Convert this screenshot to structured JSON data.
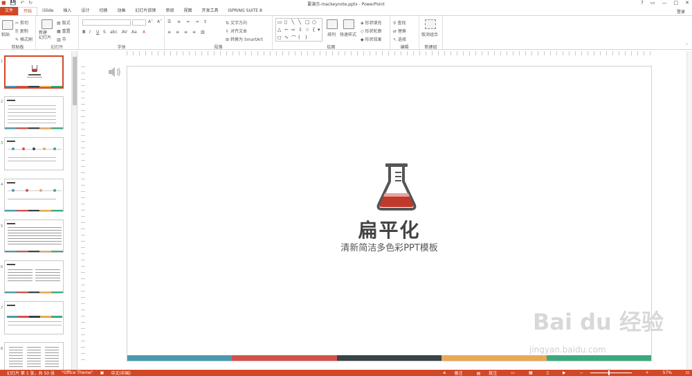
{
  "window": {
    "title": "要演示-mackeynote.pptx - PowerPoint",
    "controls": [
      "?",
      "▭",
      "—",
      "□",
      "✕"
    ],
    "signin": "登录"
  },
  "qat": {
    "save_icon": "save-icon",
    "undo_icon": "undo-icon",
    "redo_icon": "redo-icon"
  },
  "tabs": [
    {
      "label": "文件"
    },
    {
      "label": "开始"
    },
    {
      "label": "iSlide"
    },
    {
      "label": "插入"
    },
    {
      "label": "设计"
    },
    {
      "label": "切换"
    },
    {
      "label": "动画"
    },
    {
      "label": "幻灯片放映"
    },
    {
      "label": "审阅"
    },
    {
      "label": "视图"
    },
    {
      "label": "开发工具"
    },
    {
      "label": "ISPRING SUITE 8"
    }
  ],
  "ribbon": {
    "clipboard": {
      "label": "剪贴板",
      "paste": "粘贴",
      "cut": "剪切",
      "copy": "复制",
      "format_painter": "格式刷"
    },
    "slides": {
      "label": "幻灯片",
      "new_slide": "新建\n幻灯片",
      "layout": "版式",
      "reset": "重置",
      "section": "节"
    },
    "font": {
      "label": "字体"
    },
    "paragraph": {
      "label": "段落",
      "text_direction": "文字方向",
      "align_text": "对齐文本",
      "smartart": "转换为 SmartArt"
    },
    "drawing": {
      "label": "绘图",
      "arrange": "排列",
      "quick_styles": "快速样式",
      "shape_fill": "形状填充",
      "shape_outline": "形状轮廓",
      "shape_effects": "形状效果"
    },
    "editing": {
      "label": "编辑",
      "find": "查找",
      "replace": "替换",
      "select": "选择"
    },
    "newgroup": {
      "label": "新建组",
      "ungroup": "取消组合"
    }
  },
  "slide": {
    "title": "扁平化",
    "subtitle": "清新简洁多色彩PPT模板",
    "bar_colors": [
      "#4a9aad",
      "#d2524a",
      "#384447",
      "#e9a955",
      "#3aaa7e"
    ]
  },
  "thumbnails": [
    {
      "num": "1"
    },
    {
      "num": "2"
    },
    {
      "num": "3"
    },
    {
      "num": "4"
    },
    {
      "num": "5"
    },
    {
      "num": "6"
    },
    {
      "num": "7"
    },
    {
      "num": "8"
    }
  ],
  "statusbar": {
    "slide_info": "幻灯片 第 1 张，共 50 张",
    "theme": "\"Office Theme\"",
    "language": "中文(中国)",
    "notes": "备注",
    "comments": "批注",
    "zoom": "57%"
  },
  "watermark": {
    "main": "Bai du 经验",
    "url": "jingyan.baidu.com"
  }
}
